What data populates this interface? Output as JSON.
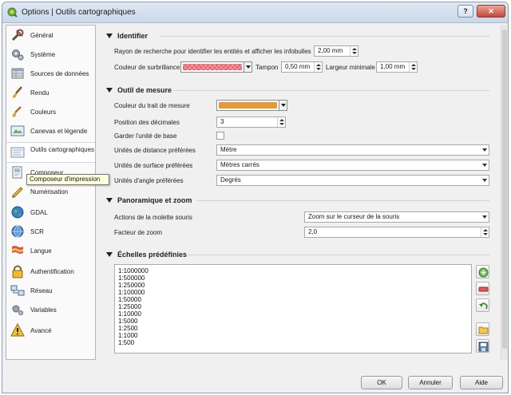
{
  "window": {
    "title": "Options | Outils cartographiques",
    "help_glyph": "?",
    "close_glyph": "✕"
  },
  "sidebar": {
    "items": [
      {
        "label": "Général",
        "icon": "wrench-icon"
      },
      {
        "label": "Système",
        "icon": "gears-icon"
      },
      {
        "label": "Sources de données",
        "icon": "datasource-icon"
      },
      {
        "label": "Rendu",
        "icon": "brush-icon"
      },
      {
        "label": "Couleurs",
        "icon": "palette-icon"
      },
      {
        "label": "Canevas et légende",
        "icon": "canvas-icon"
      },
      {
        "label": "Outils cartographiques",
        "icon": "map-tools-icon",
        "active": true
      },
      {
        "label": "Composeur",
        "icon": "composer-icon"
      },
      {
        "label": "Numérisation",
        "icon": "digitizing-icon"
      },
      {
        "label": "GDAL",
        "icon": "gdal-globe-icon"
      },
      {
        "label": "SCR",
        "icon": "crs-globe-icon"
      },
      {
        "label": "Langue",
        "icon": "flag-icon"
      },
      {
        "label": "Authentification",
        "icon": "lock-icon"
      },
      {
        "label": "Réseau",
        "icon": "network-icon"
      },
      {
        "label": "Variables",
        "icon": "variables-icon"
      },
      {
        "label": "Avancé",
        "icon": "warning-icon"
      }
    ],
    "tooltip": "Composeur d'impression"
  },
  "identify": {
    "title": "Identifier",
    "search_radius_label": "Rayon de recherche pour identifier les entités et afficher les infobulles",
    "search_radius_value": "2,00 mm",
    "highlight_color_label": "Couleur de surbrillance",
    "highlight_color": "#e8646e",
    "buffer_label": "Tampon",
    "buffer_value": "0,50 mm",
    "min_width_label": "Largeur minimale",
    "min_width_value": "1,00 mm"
  },
  "measure": {
    "title": "Outil de mesure",
    "rubberband_color_label": "Couleur du trait de mesure",
    "rubberband_color": "#e39a3c",
    "decimals_label": "Position des décimales",
    "decimals_value": "3",
    "keep_units_label": "Garder l'unité de base",
    "distance_units_label": "Unités de distance préférées",
    "distance_units_value": "Mètre",
    "area_units_label": "Unités de surface préférées",
    "area_units_value": "Mètres carrés",
    "angle_units_label": "Unités d'angle préférées",
    "angle_units_value": "Degrés"
  },
  "pan_zoom": {
    "title": "Panoramique et zoom",
    "wheel_action_label": "Actions de la molette souris",
    "wheel_action_value": "Zoom sur le curseur de la souris",
    "zoom_factor_label": "Facteur de zoom",
    "zoom_factor_value": "2,0"
  },
  "scales": {
    "title": "Échelles prédéfinies",
    "items": [
      "1:1000000",
      "1:500000",
      "1:250000",
      "1:100000",
      "1:50000",
      "1:25000",
      "1:10000",
      "1:5000",
      "1:2500",
      "1:1000",
      "1:500"
    ]
  },
  "buttons": {
    "ok": "OK",
    "cancel": "Annuler",
    "help": "Aide"
  }
}
